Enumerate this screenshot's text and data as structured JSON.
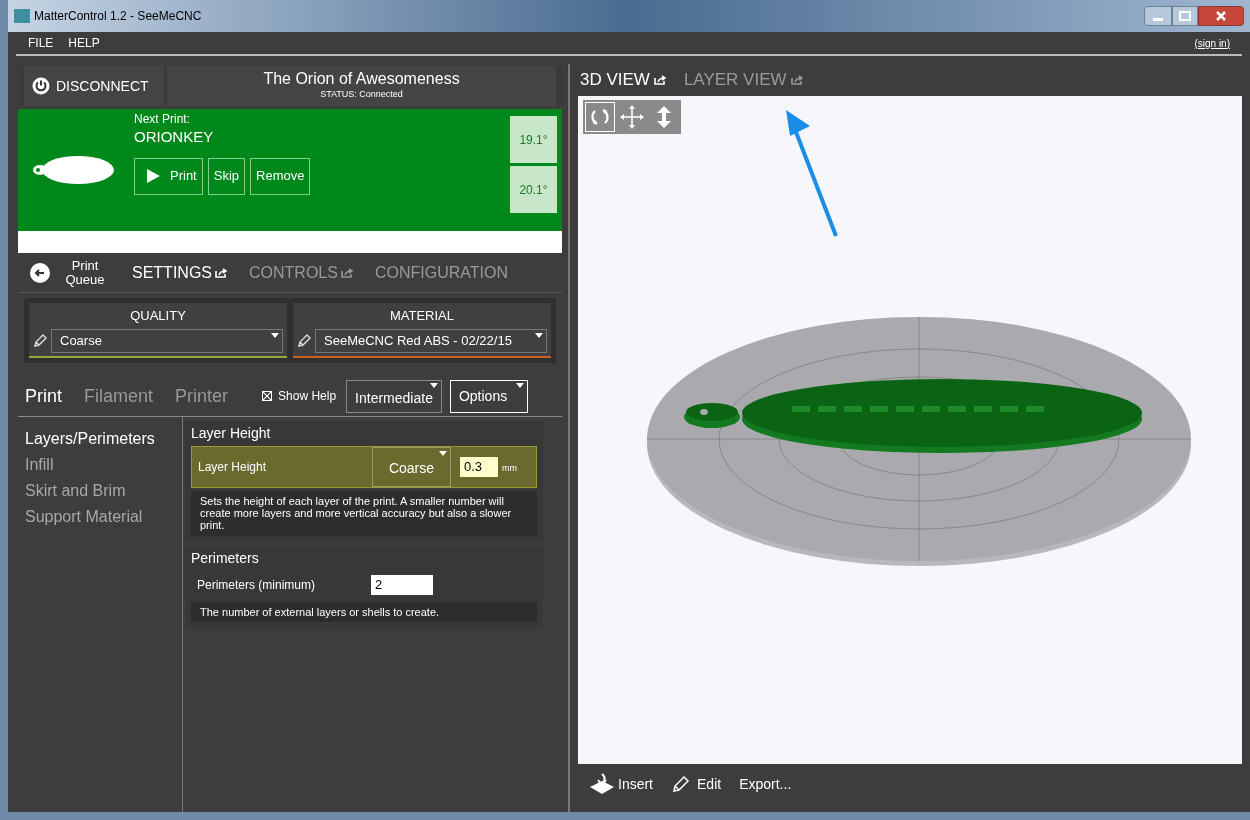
{
  "window": {
    "title": "MatterControl 1.2 - SeeMeCNC"
  },
  "menu": [
    "FILE",
    "HELP"
  ],
  "sign_in": "(sign in)",
  "printer": {
    "disconnect": "DISCONNECT",
    "name": "The Orion of Awesomeness",
    "status": "STATUS: Connected"
  },
  "queue": {
    "label": "Next Print:",
    "name": "ORIONKEY",
    "buttons": [
      {
        "label": "Print",
        "kind": "play"
      },
      {
        "label": "Skip",
        "kind": "plain"
      },
      {
        "label": "Remove",
        "kind": "plain"
      }
    ],
    "temps": [
      "19.1°",
      "20.1°"
    ]
  },
  "back": {
    "label": "Print Queue"
  },
  "tabs": [
    {
      "label": "SETTINGS",
      "selected": true,
      "popout": true
    },
    {
      "label": "CONTROLS",
      "selected": false,
      "popout": true
    },
    {
      "label": "CONFIGURATION",
      "selected": false,
      "popout": false
    }
  ],
  "presets": [
    {
      "title": "QUALITY",
      "value": "Coarse",
      "color": "#9aa83a"
    },
    {
      "title": "MATERIAL",
      "value": "SeeMeCNC Red ABS - 02/22/15",
      "color": "#c8641e"
    }
  ],
  "settings_tabs": [
    {
      "label": "Print",
      "selected": true
    },
    {
      "label": "Filament",
      "selected": false
    },
    {
      "label": "Printer",
      "selected": false
    }
  ],
  "show_help": {
    "label": "Show Help",
    "checked": true
  },
  "level_dropdown": "Intermediate",
  "options_dropdown": "Options",
  "categories": [
    {
      "label": "Layers/Perimeters",
      "selected": true
    },
    {
      "label": "Infill",
      "selected": false
    },
    {
      "label": "Skirt and Brim",
      "selected": false
    },
    {
      "label": "Support Material",
      "selected": false
    }
  ],
  "groups": [
    {
      "title": "Layer Height",
      "settings": [
        {
          "label": "Layer Height",
          "highlighted": true,
          "preset": "Coarse",
          "value": "0.3",
          "unit": "mm",
          "help": "Sets the height of each layer of the print. A smaller number will create more layers and more vertical accuracy but also a slower print."
        }
      ]
    },
    {
      "title": "Perimeters",
      "settings": [
        {
          "label": "Perimeters (minimum)",
          "highlighted": false,
          "value": "2",
          "help": "The number of external layers or shells to create."
        }
      ]
    }
  ],
  "view_tabs": [
    {
      "label": "3D VIEW",
      "selected": true
    },
    {
      "label": "LAYER VIEW",
      "selected": false
    }
  ],
  "view_tools": [
    {
      "kind": "rotate",
      "selected": true
    },
    {
      "kind": "move",
      "selected": false
    },
    {
      "kind": "zoom",
      "selected": false
    }
  ],
  "actions": [
    {
      "label": "Insert",
      "kind": "insert"
    },
    {
      "label": "Edit",
      "kind": "edit"
    },
    {
      "label": "Export...",
      "kind": "plain"
    }
  ]
}
